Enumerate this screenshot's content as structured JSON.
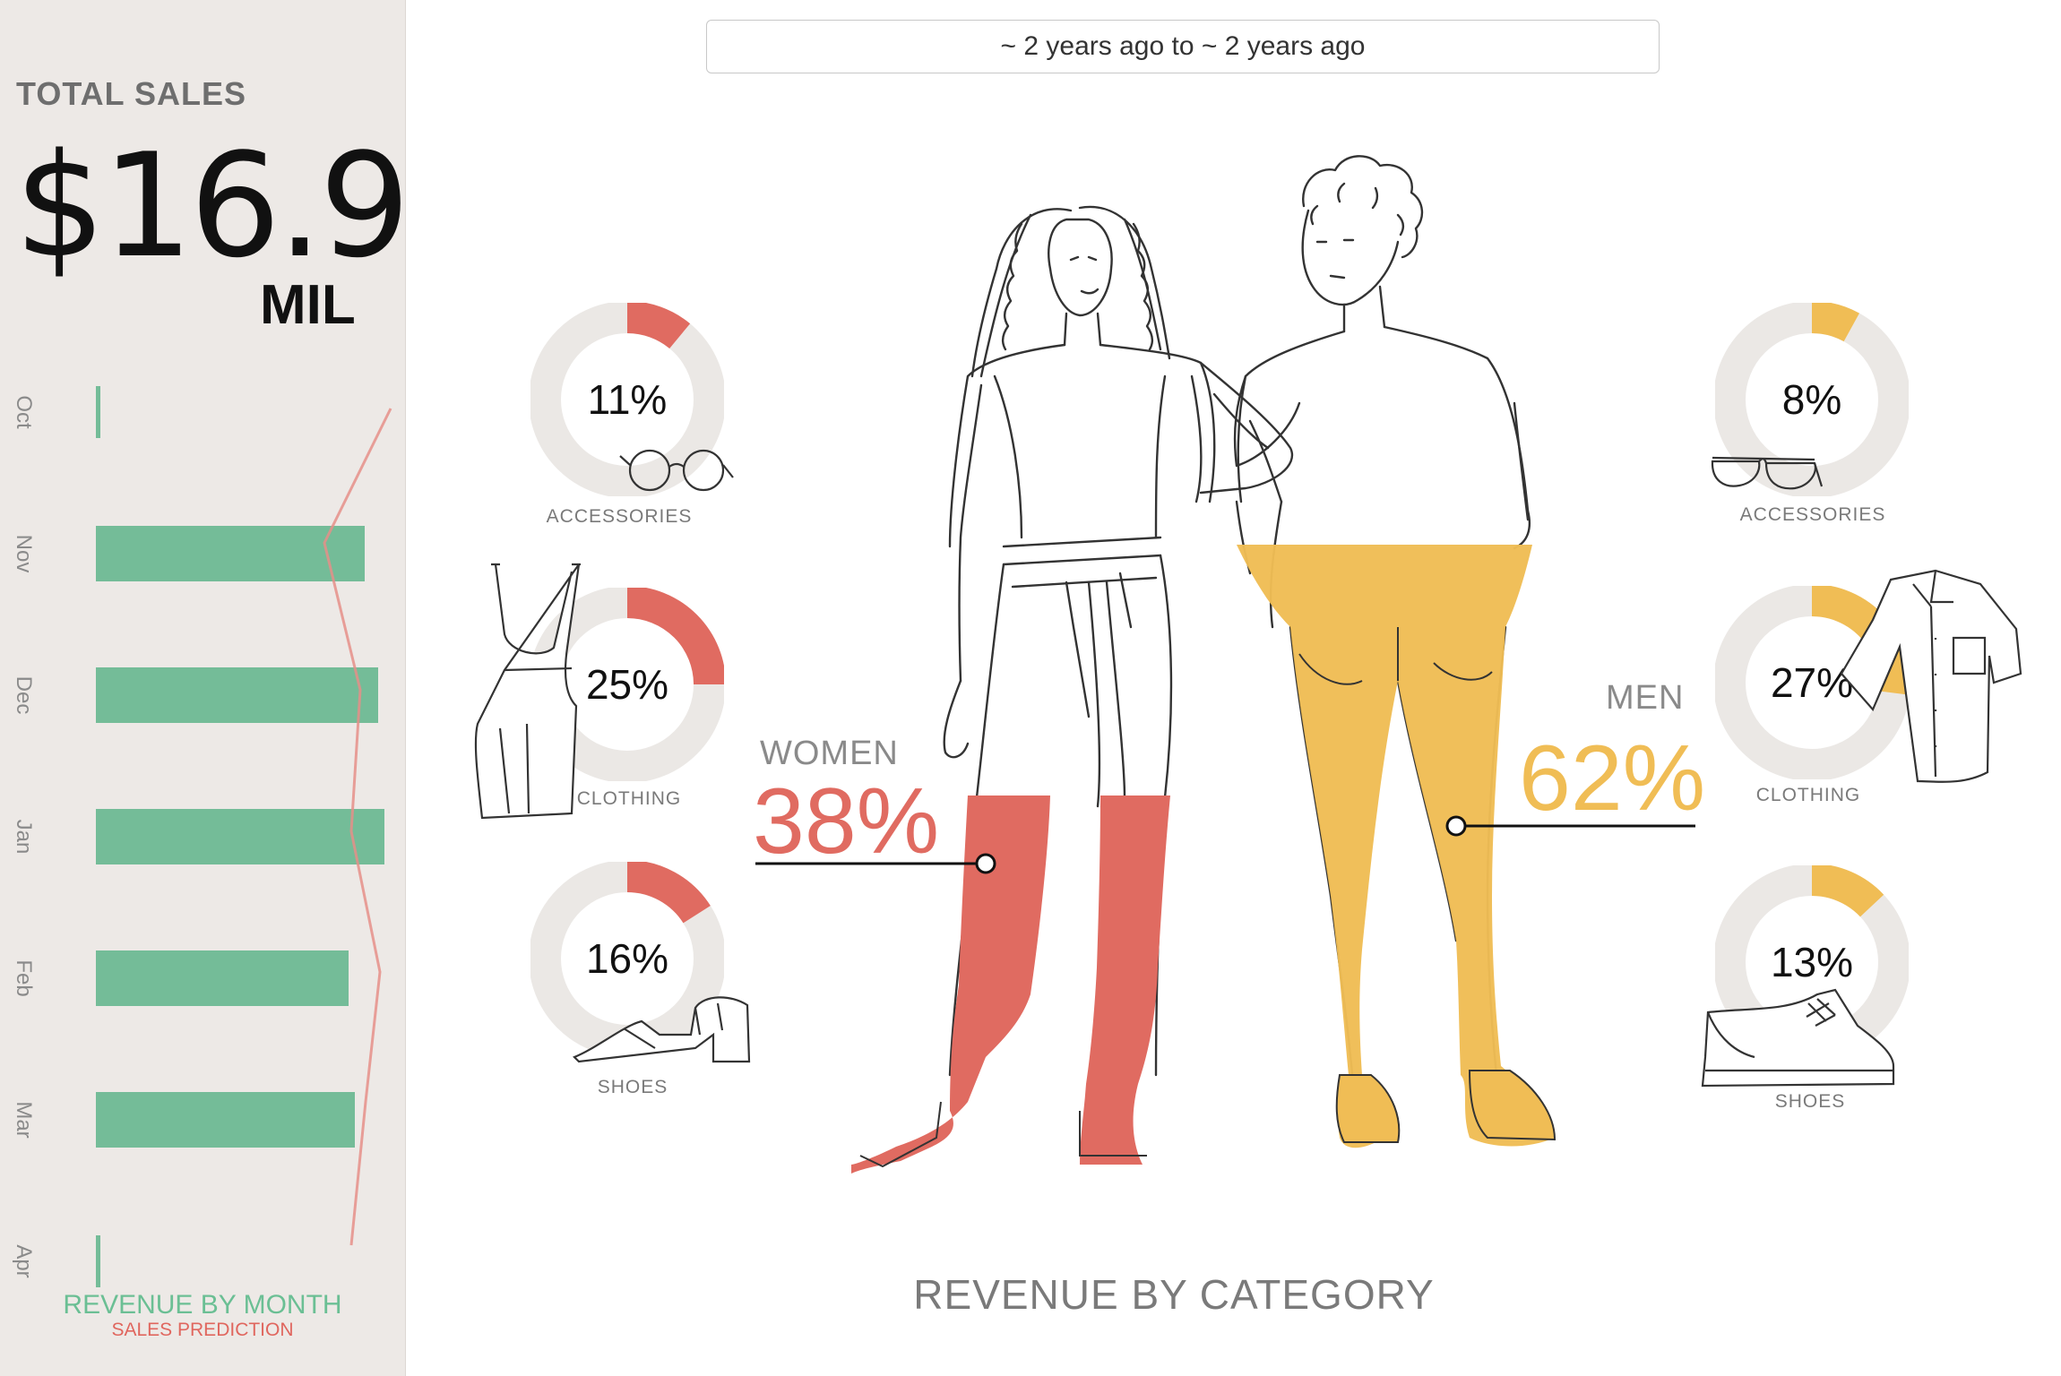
{
  "sidebar": {
    "total_title": "TOTAL SALES",
    "total_value": "$16.9",
    "total_unit": "MIL",
    "revenue_by_month_title": "REVENUE BY MONTH",
    "sales_prediction_title": "SALES PREDICTION"
  },
  "date_range": "~ 2 years ago to ~ 2 years ago",
  "women": {
    "label": "WOMEN",
    "pct": "38%",
    "categories": [
      {
        "label": "ACCESSORIES",
        "pct": "11%",
        "value": 11
      },
      {
        "label": "CLOTHING",
        "pct": "25%",
        "value": 25
      },
      {
        "label": "SHOES",
        "pct": "16%",
        "value": 16
      }
    ]
  },
  "men": {
    "label": "MEN",
    "pct": "62%",
    "categories": [
      {
        "label": "ACCESSORIES",
        "pct": "8%",
        "value": 8
      },
      {
        "label": "CLOTHING",
        "pct": "27%",
        "value": 27
      },
      {
        "label": "SHOES",
        "pct": "13%",
        "value": 13
      }
    ]
  },
  "bottom_title": "REVENUE BY CATEGORY",
  "colors": {
    "women": "#e06b61",
    "men": "#f0bd55",
    "bar": "#74bc98",
    "prediction": "#e58f88",
    "donut_track": "#ebe8e5",
    "sidebar_bg": "#ede9e6"
  },
  "chart_data": {
    "type": "bar",
    "orientation": "horizontal",
    "categories": [
      "Oct",
      "Nov",
      "Dec",
      "Jan",
      "Feb",
      "Mar",
      "Apr"
    ],
    "series": [
      {
        "name": "REVENUE BY MONTH",
        "values": [
          0.05,
          3.0,
          3.15,
          3.22,
          2.82,
          2.89,
          0.05
        ]
      },
      {
        "name": "SALES PREDICTION",
        "type": "line",
        "values": [
          3.3,
          2.6,
          3.1,
          2.9,
          3.2,
          3.0,
          2.8
        ]
      }
    ],
    "title": "REVENUE BY MONTH",
    "subtitle": "SALES PREDICTION"
  }
}
